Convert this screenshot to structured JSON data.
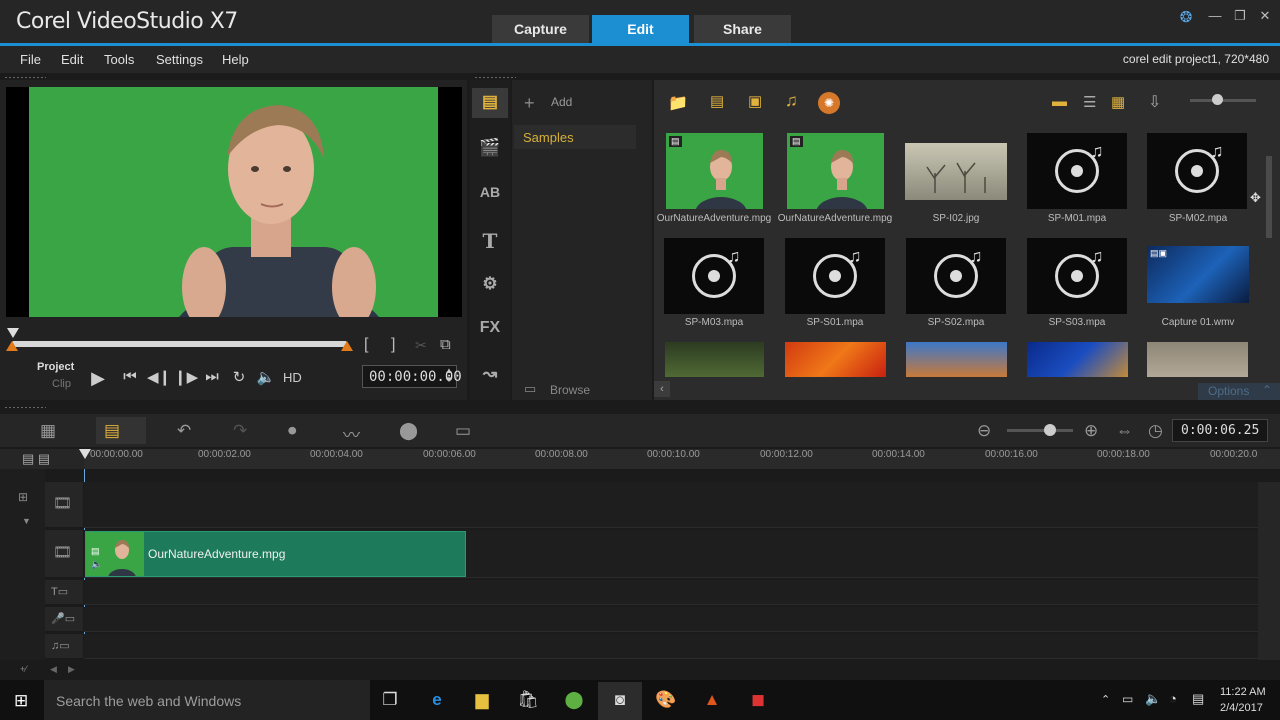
{
  "app": {
    "title": "Corel VideoStudio X7"
  },
  "tabs": [
    {
      "label": "Capture"
    },
    {
      "label": "Edit"
    },
    {
      "label": "Share"
    }
  ],
  "menu": {
    "items": [
      "File",
      "Edit",
      "Tools",
      "Settings",
      "Help"
    ],
    "project_info": "corel edit project1, 720*480"
  },
  "player": {
    "project_label": "Project",
    "clip_label": "Clip",
    "hd_label": "HD",
    "timecode": "00:00:00.00"
  },
  "library": {
    "add_label": "Add",
    "folder": "Samples",
    "browse_label": "Browse",
    "options_label": "Options",
    "items": [
      {
        "name": "OurNatureAdventure.mpg",
        "kind": "video"
      },
      {
        "name": "OurNatureAdventure.mpg",
        "kind": "video"
      },
      {
        "name": "SP-I02.jpg",
        "kind": "image"
      },
      {
        "name": "SP-M01.mpa",
        "kind": "audio"
      },
      {
        "name": "SP-M02.mpa",
        "kind": "audio"
      },
      {
        "name": "SP-M03.mpa",
        "kind": "audio"
      },
      {
        "name": "SP-S01.mpa",
        "kind": "audio"
      },
      {
        "name": "SP-S02.mpa",
        "kind": "audio"
      },
      {
        "name": "SP-S03.mpa",
        "kind": "audio"
      },
      {
        "name": "Capture 01.wmv",
        "kind": "screen"
      }
    ]
  },
  "timeline": {
    "duration": "0:00:06.25",
    "ruler": [
      "00:00:00.00",
      "00:00:02.00",
      "00:00:04.00",
      "00:00:06.00",
      "00:00:08.00",
      "00:00:10.00",
      "00:00:12.00",
      "00:00:14.00",
      "00:00:16.00",
      "00:00:18.00",
      "00:00:20.0"
    ],
    "clip_name": "OurNatureAdventure.mpg"
  },
  "taskbar": {
    "search_placeholder": "Search the web and Windows",
    "time": "11:22 AM",
    "date": "2/4/2017"
  },
  "colors": {
    "accent": "#1b8fd2",
    "chroma": "#3aa545",
    "clip": "#1d7b5c"
  }
}
